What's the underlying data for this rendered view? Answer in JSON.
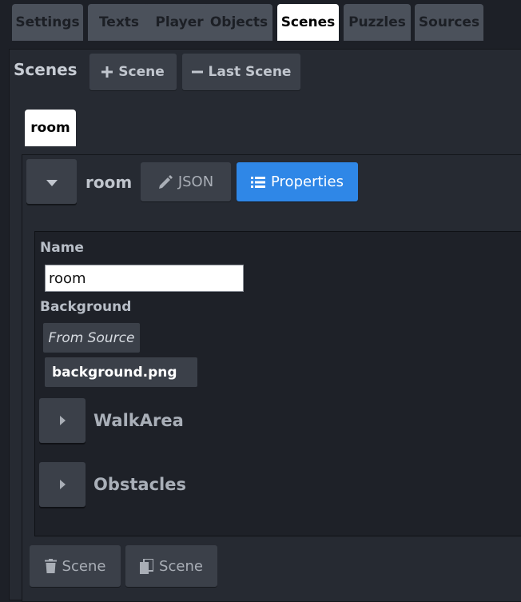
{
  "tabs": [
    {
      "label": "Settings",
      "active": false
    },
    {
      "label": "Texts",
      "active": false
    },
    {
      "label": "Player",
      "active": false
    },
    {
      "label": "Objects",
      "active": false
    },
    {
      "label": "Scenes",
      "active": true
    },
    {
      "label": "Puzzles",
      "active": false
    },
    {
      "label": "Sources",
      "active": false
    }
  ],
  "scenes": {
    "title": "Scenes",
    "add_scene_label": "Scene",
    "remove_last_scene_label": "Last Scene",
    "scene_tab_label": "room"
  },
  "scene": {
    "name": "room",
    "json_label": "JSON",
    "properties_label": "Properties"
  },
  "properties": {
    "name_label": "Name",
    "name_value": "room",
    "background_label": "Background",
    "from_source_label": "From Source",
    "background_file": "background.png",
    "sections": [
      {
        "title": "WalkArea"
      },
      {
        "title": "Obstacles"
      }
    ]
  },
  "footer": {
    "delete_scene_label": "Scene",
    "copy_scene_label": "Scene"
  },
  "colors": {
    "background": "#1d2027",
    "panel": "#262a32",
    "button": "#3b4049",
    "accent": "#2f87e7",
    "active_tab": "#ffffff"
  }
}
